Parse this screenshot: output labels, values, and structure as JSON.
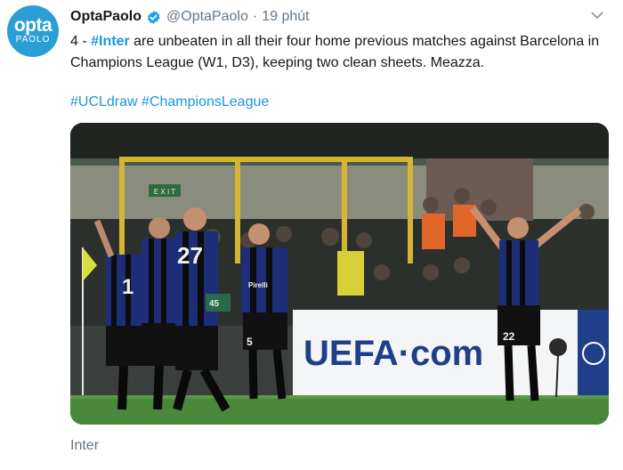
{
  "tweet": {
    "avatar_top": "opta",
    "avatar_bottom": "PAOLO",
    "display_name": "OptaPaolo",
    "handle": "@OptaPaolo",
    "separator": "·",
    "time": "19 phút",
    "text_prefix": "4 - ",
    "text_hashtag": "#Inter",
    "text_rest": " are unbeaten in all their four home previous matches against Barcelona in Champions League (W1, D3), keeping two clean sheets. Meazza.",
    "hashtag_1": "#UCLdraw",
    "hashtag_2": "#ChampionsLeague",
    "caption": "Inter"
  },
  "photo": {
    "board_text": "UEFA·com",
    "exit_sign": "E X I T",
    "jersey_left_number": "1",
    "jersey_center_number": "27",
    "jersey_right_number": "22",
    "shorts_center_number": "5",
    "sponsor": "Pirelli",
    "steward_tag": "45"
  },
  "colors": {
    "accent": "#1b95e0",
    "muted": "#657786",
    "brand_avatar": "#2a9fd6"
  }
}
